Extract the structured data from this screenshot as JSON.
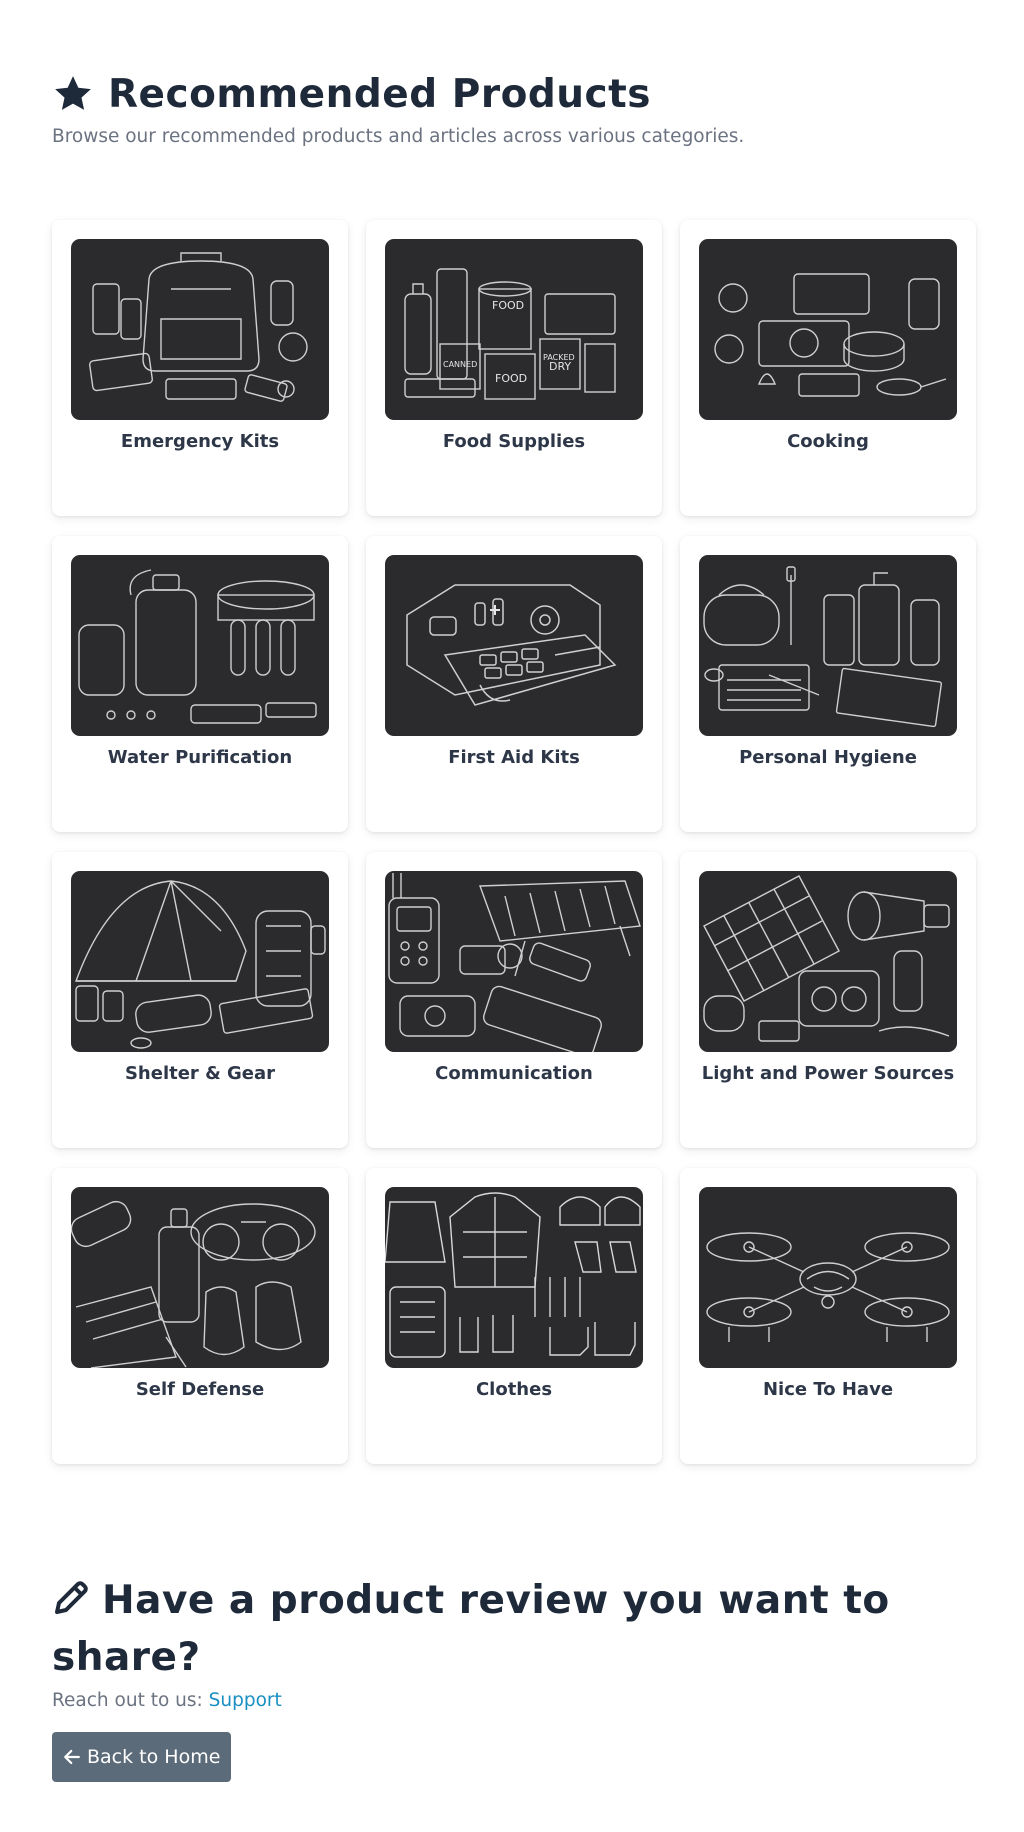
{
  "header": {
    "title": "Recommended Products",
    "subtitle": "Browse our recommended products and articles across various categories.",
    "icon": "star-icon"
  },
  "categories": [
    {
      "label": "Emergency Kits",
      "icon": "backpack-kit-image"
    },
    {
      "label": "Food Supplies",
      "icon": "canned-food-image"
    },
    {
      "label": "Cooking",
      "icon": "camp-stove-image"
    },
    {
      "label": "Water Purification",
      "icon": "water-filter-image"
    },
    {
      "label": "First Aid Kits",
      "icon": "first-aid-case-image"
    },
    {
      "label": "Personal Hygiene",
      "icon": "hygiene-bottles-image"
    },
    {
      "label": "Shelter & Gear",
      "icon": "tent-image"
    },
    {
      "label": "Communication",
      "icon": "radio-solar-panel-image"
    },
    {
      "label": "Light and Power Sources",
      "icon": "flashlight-solar-image"
    },
    {
      "label": "Self Defense",
      "icon": "gas-mask-gloves-image"
    },
    {
      "label": "Clothes",
      "icon": "jacket-boots-image"
    },
    {
      "label": "Nice To Have",
      "icon": "drone-image"
    }
  ],
  "review": {
    "heading": "Have a product review you want to share?",
    "reach_text": "Reach out to us: ",
    "support_link": "Support",
    "back_button": "Back to Home",
    "icon": "pencil-icon"
  },
  "colors": {
    "heading": "#1e2939",
    "muted": "#6b7280",
    "link": "#1a8fc4",
    "button": "#5c6b7a",
    "thumb_bg": "#2b2b2d"
  }
}
